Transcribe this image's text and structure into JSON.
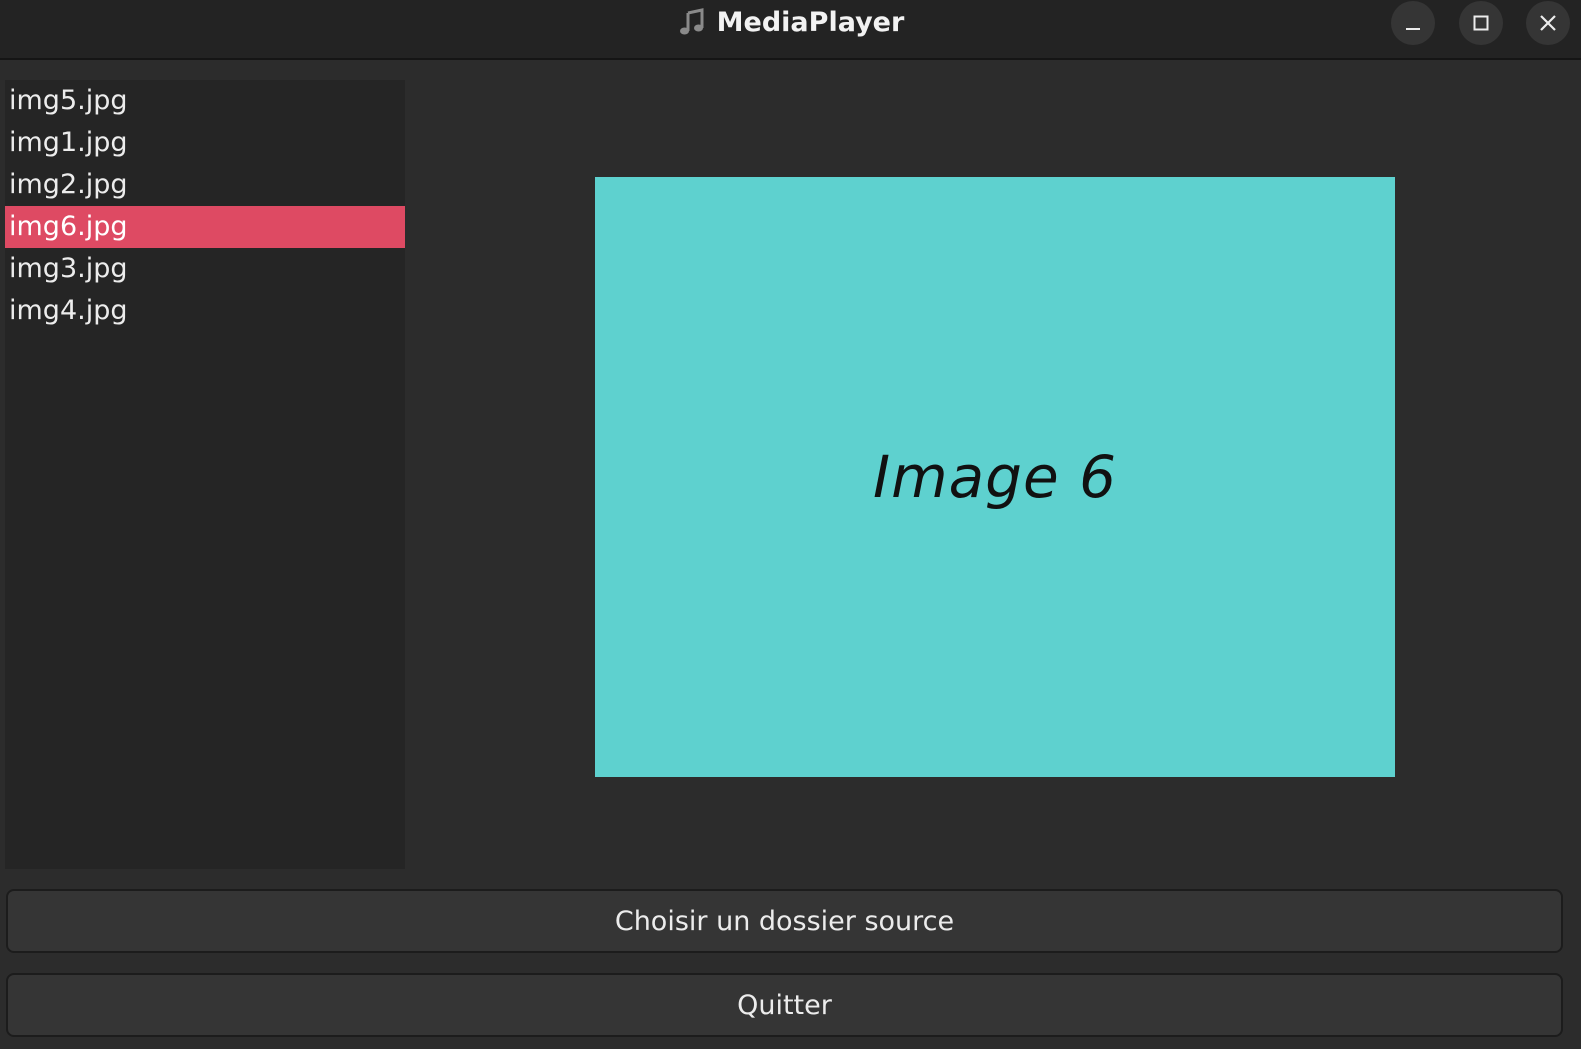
{
  "window": {
    "title": "MediaPlayer",
    "app_icon": "music-note-icon"
  },
  "controls": {
    "minimize_icon": "minimize-icon",
    "maximize_icon": "maximize-icon",
    "close_icon": "close-icon"
  },
  "file_list": {
    "items": [
      {
        "label": "img5.jpg",
        "selected": false
      },
      {
        "label": "img1.jpg",
        "selected": false
      },
      {
        "label": "img2.jpg",
        "selected": false
      },
      {
        "label": "img6.jpg",
        "selected": true
      },
      {
        "label": "img3.jpg",
        "selected": false
      },
      {
        "label": "img4.jpg",
        "selected": false
      }
    ],
    "selected_color": "#de4a63"
  },
  "preview": {
    "caption": "Image 6",
    "background_color": "#5ed1cf"
  },
  "buttons": {
    "choose_source_label": "Choisir un dossier source",
    "quit_label": "Quitter"
  }
}
